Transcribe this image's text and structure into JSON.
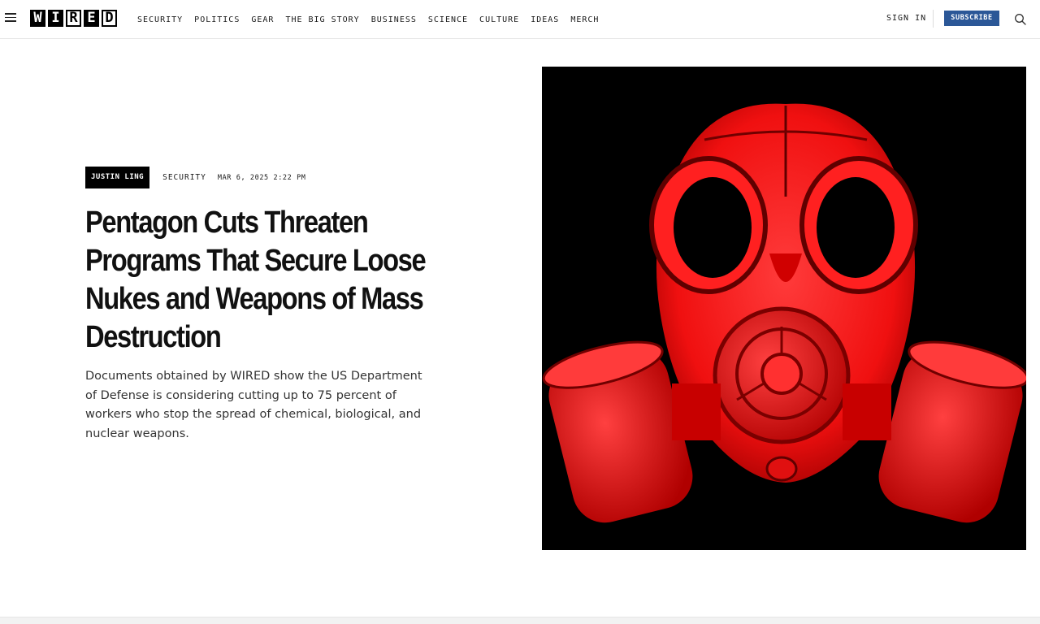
{
  "header": {
    "logo_letters": [
      "W",
      "I",
      "R",
      "E",
      "D"
    ],
    "nav": [
      "SECURITY",
      "POLITICS",
      "GEAR",
      "THE BIG STORY",
      "BUSINESS",
      "SCIENCE",
      "CULTURE",
      "IDEAS",
      "MERCH"
    ],
    "sign_in": "SIGN IN",
    "subscribe": "SUBSCRIBE",
    "icons": {
      "menu": "hamburger-icon",
      "search": "search-icon"
    }
  },
  "article": {
    "author": "JUSTIN LING",
    "rubric": "SECURITY",
    "date": "MAR 6, 2025 2:22 PM",
    "headline": "Pentagon Cuts Threaten Programs That Secure Loose Nukes and Weapons of Mass Destruction",
    "dek": "Documents obtained by WIRED show the US Department of Defense is considering cutting up to 75 percent of workers who stop the spread of chemical, biological, and nuclear weapons."
  },
  "colors": {
    "subscribe_bg": "#2b5797",
    "image_red": "#ff1a1a",
    "image_bg": "#000000"
  }
}
